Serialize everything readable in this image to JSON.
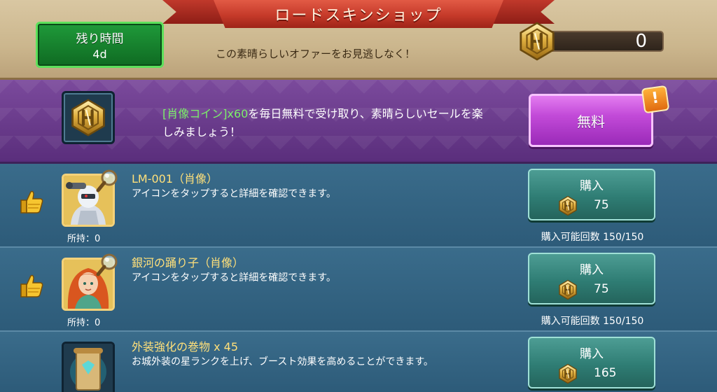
{
  "header": {
    "title": "ロードスキンショップ",
    "timer_label": "残り時間",
    "timer_value": "4d",
    "promo_text": "この素晴らしいオファーをお見逃しなく！",
    "coin_balance": "0"
  },
  "free_offer": {
    "desc_highlight": "[肖像コイン]x60",
    "desc_rest": "を毎日無料で受け取り、素晴らしいセールを楽しみましょう！",
    "button_label": "無料",
    "badge": "!"
  },
  "items": [
    {
      "name": "LM-001（肖像）",
      "desc": "アイコンをタップすると詳細を確認できます。",
      "owned": "所持：0",
      "buy_label": "購入",
      "price": "75",
      "limit": "購入可能回数 150/150"
    },
    {
      "name": "銀河の踊り子（肖像）",
      "desc": "アイコンをタップすると詳細を確認できます。",
      "owned": "所持：0",
      "buy_label": "購入",
      "price": "75",
      "limit": "購入可能回数 150/150"
    },
    {
      "name": "外装強化の巻物 x 45",
      "desc": "お城外装の星ランクを上げ、ブースト効果を高めることができます。",
      "buy_label": "購入",
      "price": "165"
    }
  ],
  "colors": {
    "accent_green": "#7cf06a",
    "item_name_yellow": "#ffe07a",
    "banner_red": "#c53a2a"
  }
}
